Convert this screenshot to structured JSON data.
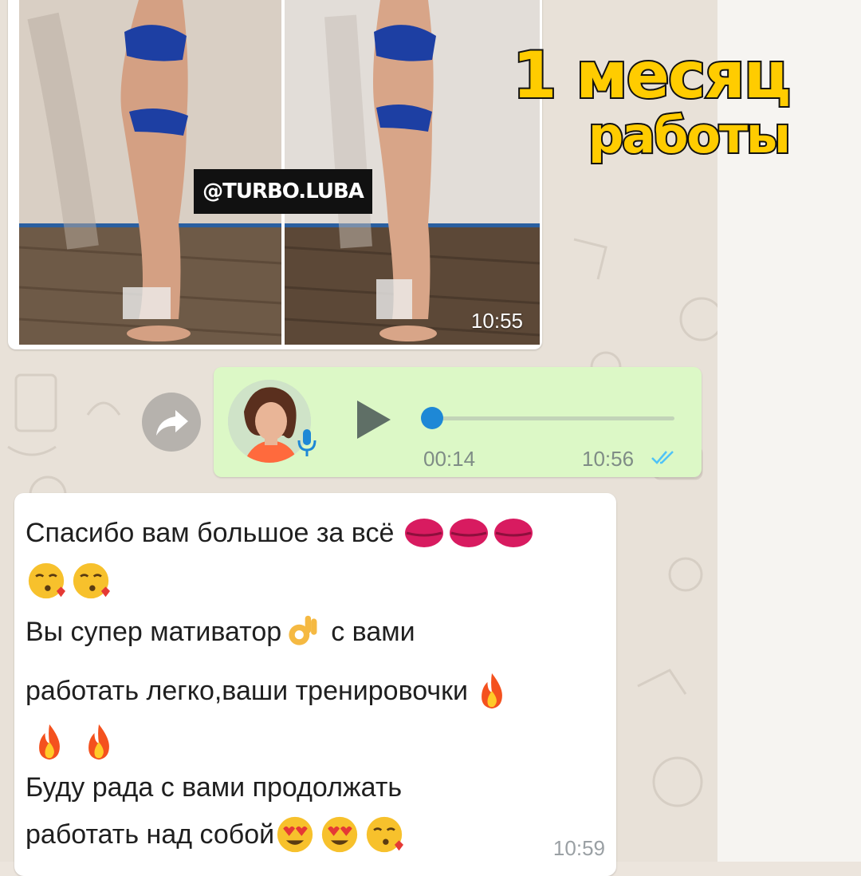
{
  "image_message": {
    "watermark": "@TURBO.LUBA",
    "timestamp": "10:55"
  },
  "caption": {
    "line1": "1 месяц",
    "line2": "работы"
  },
  "voice_message": {
    "duration": "00:14",
    "timestamp": "10:56",
    "status_icon": "double-check-icon",
    "play_icon": "play-icon",
    "mic_icon": "mic-icon"
  },
  "text_message": {
    "lines": [
      "Спасибо вам большое за всё",
      "",
      "Вы супер мативатор",
      "с вами",
      "работать легко,ваши тренировочки",
      "",
      "Буду рада с вами продолжать",
      "работать над собой"
    ],
    "emoji": {
      "line1": [
        "kiss-mark",
        "kiss-mark",
        "kiss-mark"
      ],
      "line2": [
        "face-blowing-kiss",
        "face-blowing-kiss"
      ],
      "line3": [
        "ok-hand"
      ],
      "line4": [
        "fire"
      ],
      "line5": [
        "fire",
        "fire"
      ],
      "line7": [
        "heart-eyes",
        "heart-eyes",
        "face-blowing-kiss"
      ]
    },
    "timestamp": "10:59"
  },
  "colors": {
    "outgoing_bubble": "#dcf8c6",
    "incoming_bubble": "#ffffff",
    "caption_fill": "#ffcc00",
    "progress_knob": "#1e88d6",
    "read_ticks": "#4fc3f7"
  }
}
